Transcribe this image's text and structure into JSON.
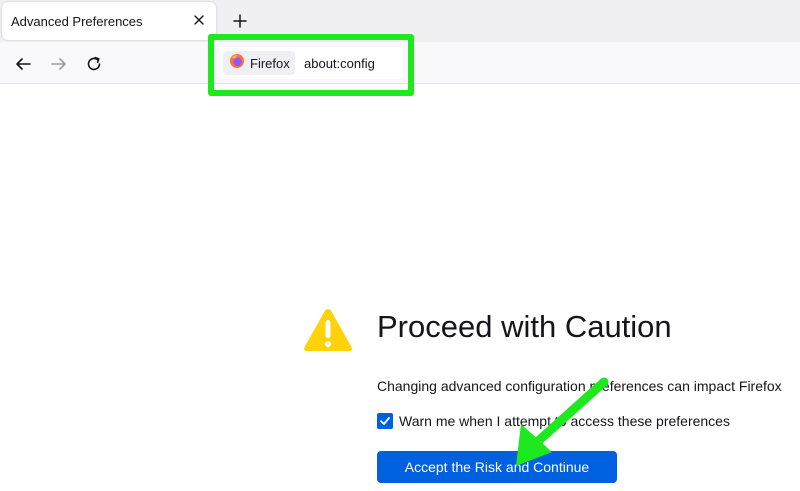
{
  "tab": {
    "title": "Advanced Preferences"
  },
  "urlbar": {
    "identity_label": "Firefox",
    "url": "about:config"
  },
  "page": {
    "title": "Proceed with Caution",
    "description": "Changing advanced configuration preferences can impact Firefox",
    "checkbox_label": "Warn me when I attempt to access these preferences",
    "checkbox_checked": true,
    "accept_button": "Accept the Risk and Continue"
  },
  "colors": {
    "accent": "#0061e0",
    "warning": "#ffd20a",
    "highlight": "#1ee81e"
  },
  "icons": [
    "close-icon",
    "plus-icon",
    "back-arrow-icon",
    "forward-arrow-icon",
    "reload-icon",
    "firefox-logo-icon",
    "warning-icon",
    "checkmark-icon"
  ]
}
